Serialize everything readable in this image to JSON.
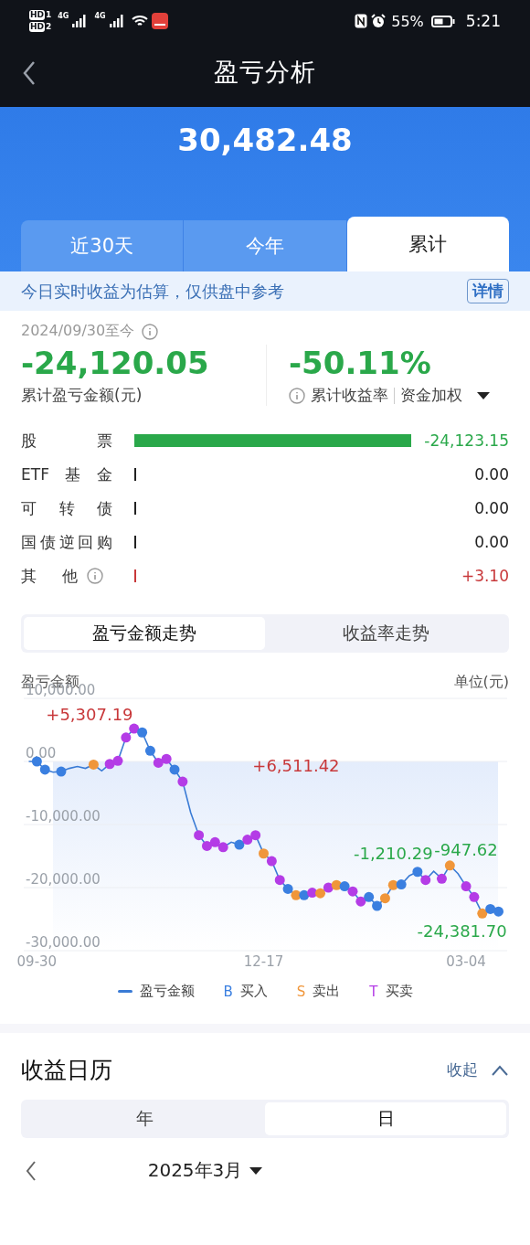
{
  "status_bar": {
    "sims": [
      {
        "badge": "HD",
        "slot": "1"
      },
      {
        "badge": "HD",
        "slot": "2"
      }
    ],
    "networks": [
      "4G",
      "4G"
    ],
    "battery": "55%",
    "time": "5:21"
  },
  "header": {
    "title": "盈亏分析"
  },
  "total": "30,482.48",
  "tabs": [
    {
      "label": "近30天",
      "selected": false
    },
    {
      "label": "今年",
      "selected": false
    },
    {
      "label": "累计",
      "selected": true
    }
  ],
  "notice": {
    "text": "今日实时收益为估算，仅供盘中参考",
    "button": "详情"
  },
  "summary": {
    "period": "2024/09/30至今",
    "amount": "-24,120.05",
    "amount_label": "累计盈亏金额(元)",
    "rate": "-50.11%",
    "rate_label": "累计收益率",
    "weighting": "资金加权"
  },
  "breakdown": [
    {
      "label": "股票",
      "kind": "bar",
      "color": "#2aa84a",
      "value": "-24,123.15",
      "info": false
    },
    {
      "label": "ETF基金",
      "kind": "tick",
      "color": "#222222",
      "value": "0.00",
      "info": false
    },
    {
      "label": "可转债",
      "kind": "tick",
      "color": "#222222",
      "value": "0.00",
      "info": false
    },
    {
      "label": "国债逆回购",
      "kind": "tick",
      "color": "#222222",
      "value": "0.00",
      "info": false
    },
    {
      "label": "其他",
      "kind": "tick",
      "color": "#c8383a",
      "value": "+3.10",
      "info": true
    }
  ],
  "chart_tabs": [
    {
      "label": "盈亏金额走势",
      "selected": true
    },
    {
      "label": "收益率走势",
      "selected": false
    }
  ],
  "chart": {
    "title": "盈亏金额",
    "unit": "单位(元)",
    "chart_data": {
      "type": "line",
      "grid": true,
      "ylim": [
        -30000,
        10000
      ],
      "yticks": [
        {
          "value": 10000,
          "label": "10,000.00"
        },
        {
          "value": 0,
          "label": "0.00"
        },
        {
          "value": -10000,
          "label": "-10,000.00"
        },
        {
          "value": -20000,
          "label": "-20,000.00"
        },
        {
          "value": -30000,
          "label": "-30,000.00"
        }
      ],
      "categories": [
        null,
        "09-30",
        null,
        null,
        null,
        null,
        null,
        null,
        null,
        null,
        null,
        null,
        null,
        null,
        null,
        null,
        null,
        null,
        null,
        null,
        null,
        null,
        null,
        null,
        null,
        null,
        null,
        null,
        null,
        "12-17",
        null,
        null,
        null,
        null,
        null,
        null,
        null,
        null,
        null,
        null,
        null,
        null,
        null,
        null,
        null,
        null,
        null,
        null,
        null,
        null,
        null,
        null,
        null,
        null,
        "03-04",
        null,
        null,
        null,
        null
      ],
      "series": [
        {
          "name": "盈亏金额",
          "color": "#3a7bd5",
          "marker": true,
          "values": [
            0,
            0,
            -1300,
            -1700,
            -1600,
            -1100,
            -800,
            -1100,
            -500,
            -1500,
            -400,
            100,
            3800,
            5200,
            4600,
            1700,
            -200,
            400,
            -1300,
            -3200,
            -8100,
            -11700,
            -13400,
            -12800,
            -13600,
            -12800,
            -13200,
            -12400,
            -11700,
            -14600,
            -15800,
            -18800,
            -20200,
            -21200,
            -21200,
            -20800,
            -20900,
            -20000,
            -19600,
            -19800,
            -20600,
            -22200,
            -21500,
            -22900,
            -21700,
            -19600,
            -19500,
            -18100,
            -17500,
            -18800,
            -17400,
            -18600,
            -16500,
            -17800,
            -19800,
            -21500,
            -24100,
            -23400,
            -23800
          ]
        }
      ],
      "annotations": [
        "+5,307.19",
        "+6,511.42",
        "-1,210.29",
        "-947.62",
        "-24,381.70"
      ]
    },
    "trades": [
      {
        "kind": "none"
      },
      {
        "kind": "buy"
      },
      {
        "kind": "buy"
      },
      {
        "kind": "none"
      },
      {
        "kind": "buy"
      },
      {
        "kind": "none"
      },
      {
        "kind": "none"
      },
      {
        "kind": "none"
      },
      {
        "kind": "sell"
      },
      {
        "kind": "none"
      },
      {
        "kind": "both"
      },
      {
        "kind": "both"
      },
      {
        "kind": "both"
      },
      {
        "kind": "both"
      },
      {
        "kind": "buy"
      },
      {
        "kind": "buy"
      },
      {
        "kind": "both"
      },
      {
        "kind": "both"
      },
      {
        "kind": "buy"
      },
      {
        "kind": "both"
      },
      {
        "kind": "none"
      },
      {
        "kind": "both"
      },
      {
        "kind": "both"
      },
      {
        "kind": "both"
      },
      {
        "kind": "both"
      },
      {
        "kind": "none"
      },
      {
        "kind": "buy"
      },
      {
        "kind": "both"
      },
      {
        "kind": "both"
      },
      {
        "kind": "sell"
      },
      {
        "kind": "both"
      },
      {
        "kind": "both"
      },
      {
        "kind": "buy"
      },
      {
        "kind": "sell"
      },
      {
        "kind": "buy"
      },
      {
        "kind": "both"
      },
      {
        "kind": "sell"
      },
      {
        "kind": "both"
      },
      {
        "kind": "sell"
      },
      {
        "kind": "buy"
      },
      {
        "kind": "both"
      },
      {
        "kind": "both"
      },
      {
        "kind": "buy"
      },
      {
        "kind": "buy"
      },
      {
        "kind": "sell"
      },
      {
        "kind": "sell"
      },
      {
        "kind": "buy"
      },
      {
        "kind": "none"
      },
      {
        "kind": "buy"
      },
      {
        "kind": "both"
      },
      {
        "kind": "none"
      },
      {
        "kind": "both"
      },
      {
        "kind": "sell"
      },
      {
        "kind": "none"
      },
      {
        "kind": "both"
      },
      {
        "kind": "both"
      },
      {
        "kind": "sell"
      },
      {
        "kind": "buy"
      },
      {
        "kind": "buy"
      }
    ],
    "legend": [
      {
        "kind": "line",
        "color": "#3a7bd5"
      },
      {
        "kind": "buy",
        "symbol": "B",
        "label": "买入",
        "color": "#3a7fe0"
      },
      {
        "kind": "sell",
        "symbol": "S",
        "label": "卖出",
        "color": "#f0963a"
      },
      {
        "kind": "both",
        "symbol": "T",
        "label": "买卖",
        "color": "#b43ce6"
      }
    ]
  },
  "calendar": {
    "title": "收益日历",
    "collapse": "收起",
    "tabs": [
      {
        "label": "年",
        "selected": false
      },
      {
        "label": "日",
        "selected": true
      }
    ],
    "month": "2025年3月"
  }
}
